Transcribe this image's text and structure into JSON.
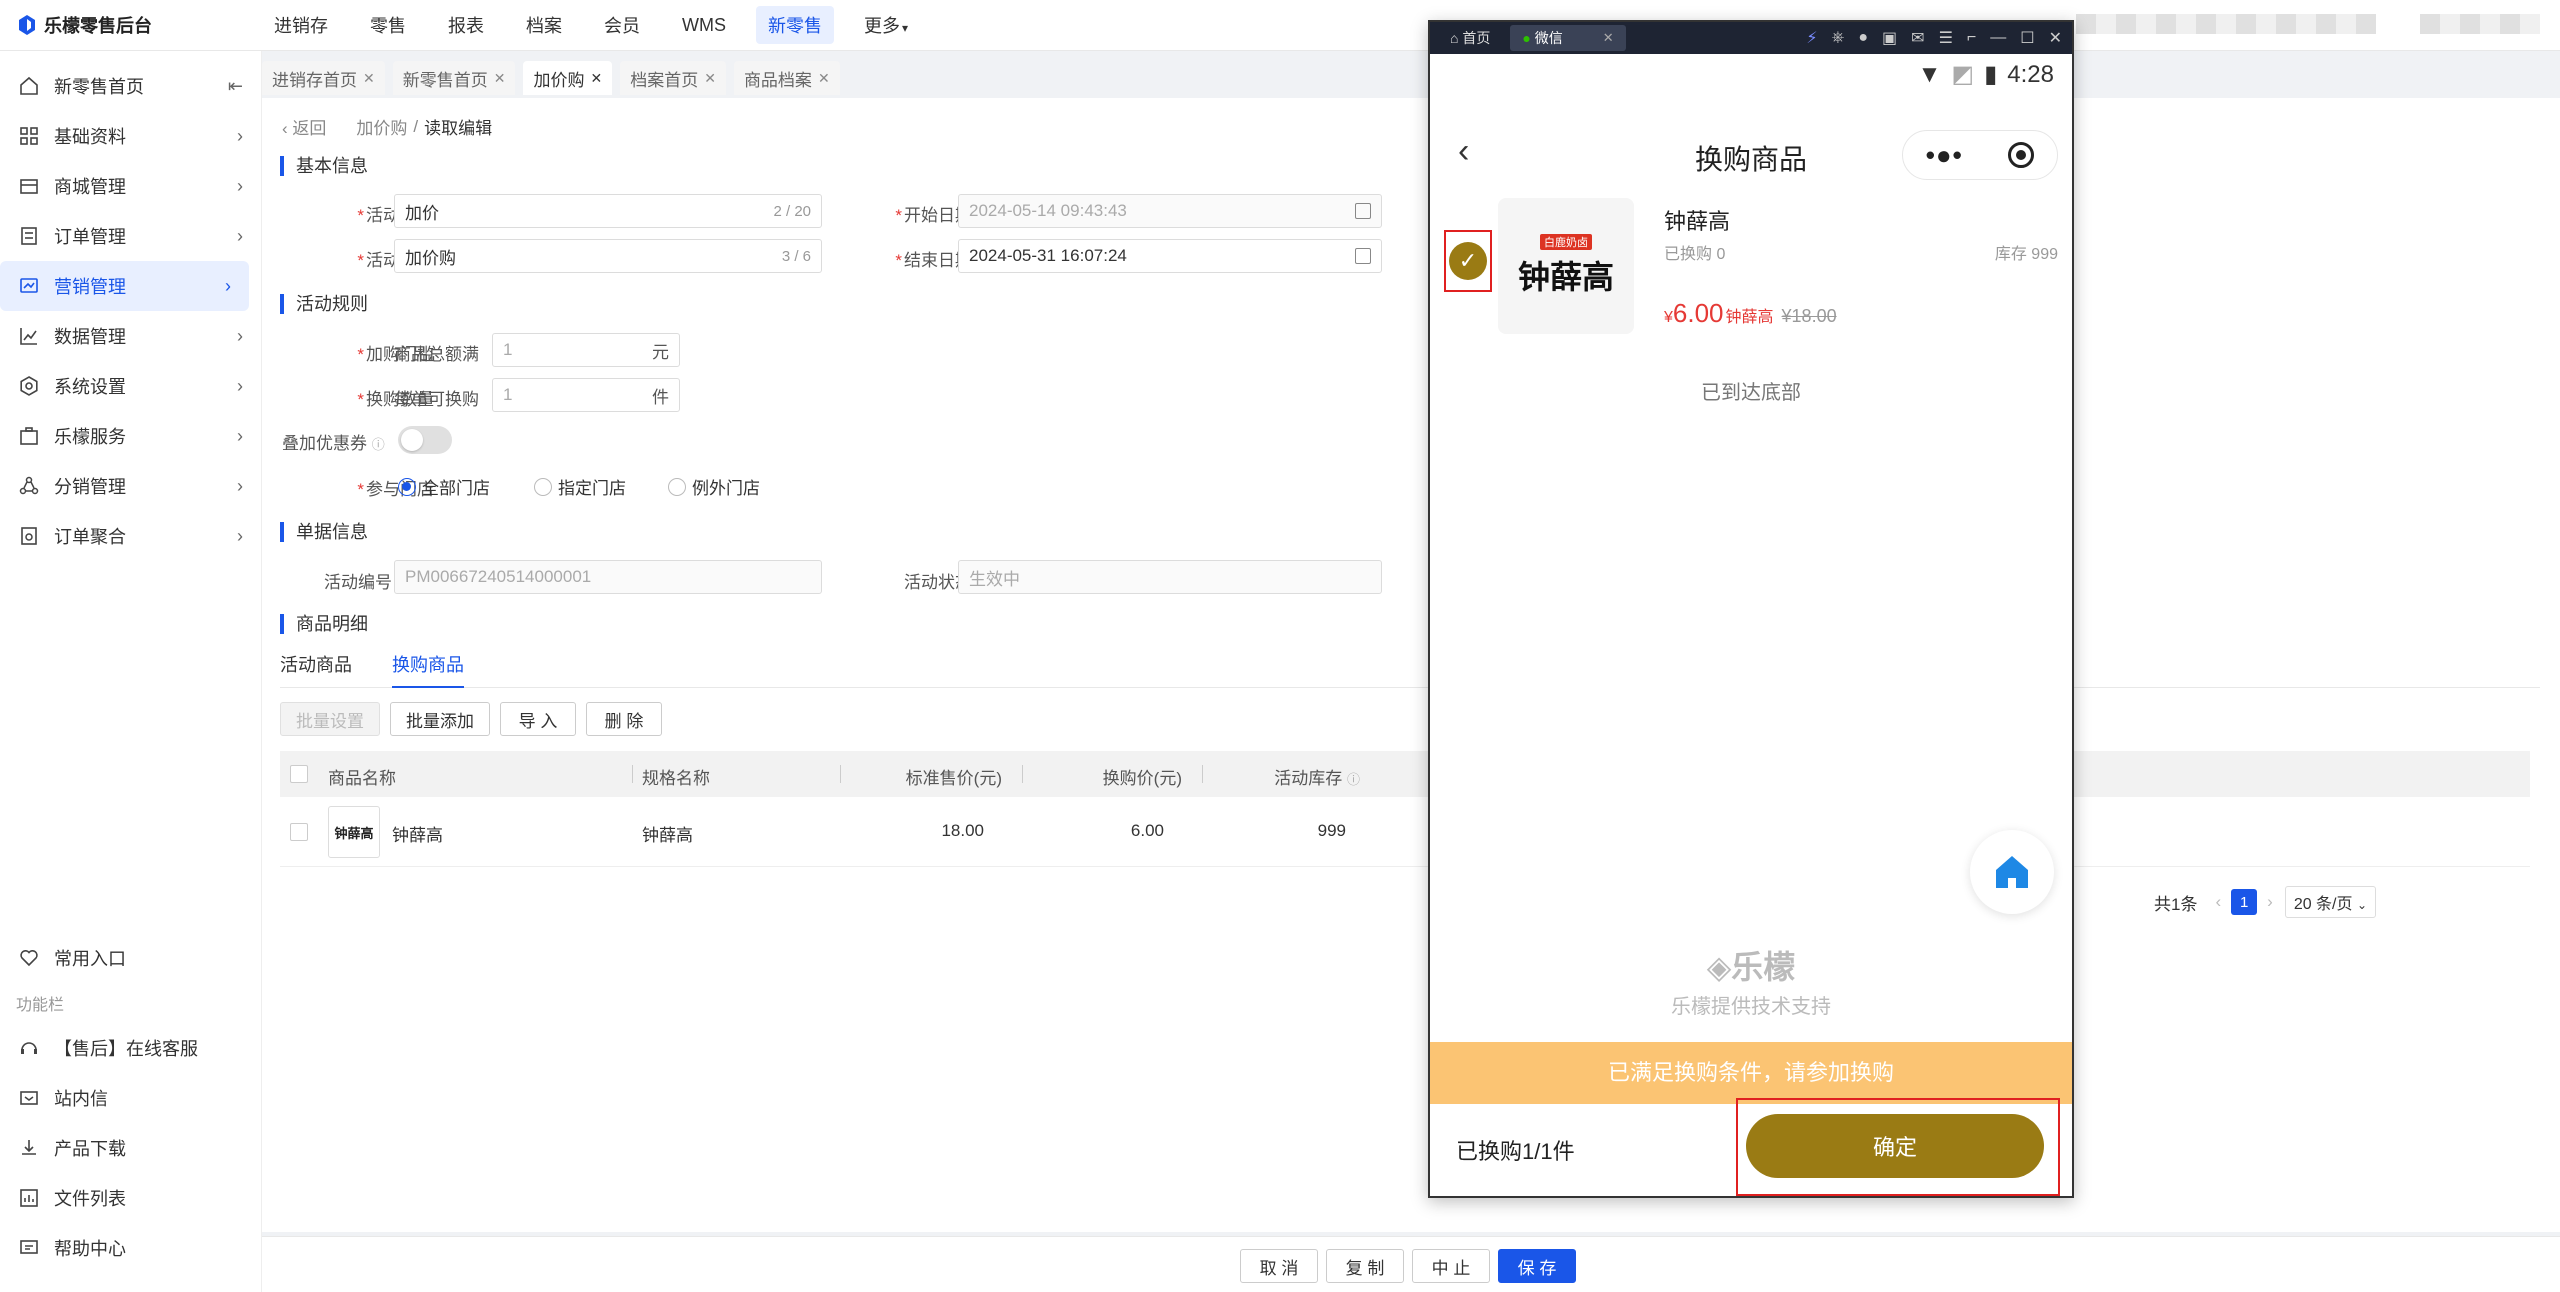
{
  "app": {
    "title": "乐檬零售后台"
  },
  "topnav": {
    "items": [
      "进销存",
      "零售",
      "报表",
      "档案",
      "会员",
      "WMS",
      "新零售",
      "更多"
    ],
    "active": "新零售"
  },
  "sidebar": {
    "items": [
      {
        "label": "新零售首页",
        "icon": "home-icon"
      },
      {
        "label": "基础资料",
        "icon": "grid-icon"
      },
      {
        "label": "商城管理",
        "icon": "store-icon"
      },
      {
        "label": "订单管理",
        "icon": "order-icon"
      },
      {
        "label": "营销管理",
        "icon": "marketing-icon"
      },
      {
        "label": "数据管理",
        "icon": "chart-icon"
      },
      {
        "label": "系统设置",
        "icon": "gear-icon"
      },
      {
        "label": "乐檬服务",
        "icon": "service-icon"
      },
      {
        "label": "分销管理",
        "icon": "distribution-icon"
      },
      {
        "label": "订单聚合",
        "icon": "aggregate-icon"
      }
    ],
    "bottom_items": [
      {
        "label": "常用入口",
        "icon": "heart-icon"
      }
    ],
    "group_label": "功能栏",
    "func_items": [
      {
        "label": "【售后】在线客服",
        "icon": "headset-icon"
      },
      {
        "label": "站内信",
        "icon": "message-icon"
      },
      {
        "label": "产品下载",
        "icon": "download-icon"
      },
      {
        "label": "文件列表",
        "icon": "file-list-icon"
      },
      {
        "label": "帮助中心",
        "icon": "help-icon"
      }
    ]
  },
  "tabs": [
    "进销存首页",
    "新零售首页",
    "加价购",
    "档案首页",
    "商品档案"
  ],
  "breadcrumb": {
    "back": "返回",
    "parent": "加价购",
    "sep": "/",
    "current": "读取编辑"
  },
  "sections": {
    "basic": "基本信息",
    "rules": "活动规则",
    "doc": "单据信息",
    "goods": "商品明细"
  },
  "form": {
    "name_label": "活动名称",
    "name_value": "加价",
    "name_count": "2 / 20",
    "tag_label": "活动标签",
    "tag_value": "加价购",
    "tag_count": "3 / 6",
    "start_label": "开始日期",
    "start_value": "2024-05-14 09:43:43",
    "end_label": "结束日期",
    "end_value": "2024-05-31 16:07:24",
    "threshold_label": "加购门槛",
    "threshold_prefix": "商品总额满",
    "threshold_placeholder": "1",
    "threshold_unit": "元",
    "qty_label": "换购数量",
    "qty_prefix": "每单可换购",
    "qty_placeholder": "1",
    "qty_unit": "件",
    "coupon_label": "叠加优惠券",
    "store_label": "参与门店",
    "store_options": [
      "全部门店",
      "指定门店",
      "例外门店"
    ],
    "code_label": "活动编号",
    "code_value": "PM00667240514000001",
    "status_label": "活动状态",
    "status_value": "生效中"
  },
  "subtabs": [
    "活动商品",
    "换购商品"
  ],
  "toolbar": {
    "batch_set": "批量设置",
    "batch_add": "批量添加",
    "import": "导 入",
    "delete": "删 除"
  },
  "table": {
    "headers": [
      "商品名称",
      "规格名称",
      "标准售价(元)",
      "换购价(元)",
      "活动库存"
    ],
    "rows": [
      {
        "name": "钟薛高",
        "spec": "钟薛高",
        "price": "18.00",
        "exchange": "6.00",
        "stock": "999"
      }
    ]
  },
  "pager": {
    "total": "共1条",
    "page": "1",
    "size": "20 条/页"
  },
  "footer": {
    "cancel": "取 消",
    "copy": "复 制",
    "stop": "中 止",
    "save": "保 存"
  },
  "phone": {
    "tab_home": "首页",
    "tab_wechat": "微信",
    "time": "4:28",
    "title": "换购商品",
    "product": {
      "name": "钟薛高",
      "sold": "已换购 0",
      "stock": "库存 999",
      "currency": "¥",
      "price": "6.00",
      "price_name": "钟薛高",
      "orig": "¥18.00",
      "brand_tag": "白鹿奶卤",
      "brand": "钟薛高"
    },
    "bottom_tip": "已到达底部",
    "brand_footer": "乐檬",
    "brand_sub": "乐檬提供技术支持",
    "banner": "已满足换购条件，请参加换购",
    "count": "已换购1/1件",
    "confirm": "确定"
  },
  "colors": {
    "accent": "#1a56e8",
    "gold": "#9a7b14",
    "banner": "#fbc473",
    "highlight": "#e02020"
  }
}
